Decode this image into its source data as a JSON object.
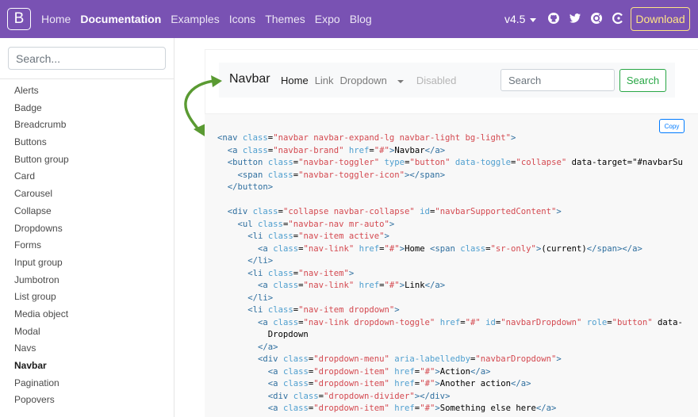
{
  "topnav": {
    "brand_letter": "B",
    "links": [
      "Home",
      "Documentation",
      "Examples",
      "Icons",
      "Themes",
      "Expo",
      "Blog"
    ],
    "active_link": "Documentation",
    "version": "v4.5",
    "icons": [
      "github-icon",
      "twitter-icon",
      "opencollective-icon",
      "slack-icon"
    ],
    "download_label": "Download"
  },
  "sidebar": {
    "search_placeholder": "Search...",
    "items": [
      "Alerts",
      "Badge",
      "Breadcrumb",
      "Buttons",
      "Button group",
      "Card",
      "Carousel",
      "Collapse",
      "Dropdowns",
      "Forms",
      "Input group",
      "Jumbotron",
      "List group",
      "Media object",
      "Modal",
      "Navs",
      "Navbar",
      "Pagination",
      "Popovers"
    ],
    "active_item": "Navbar"
  },
  "example": {
    "brand": "Navbar",
    "home": "Home",
    "link": "Link",
    "dropdown": "Dropdown",
    "disabled": "Disabled",
    "search_placeholder": "Search",
    "search_button": "Search"
  },
  "code": {
    "copy_label": "Copy",
    "lines": [
      "<nav class=\"navbar navbar-expand-lg navbar-light bg-light\">",
      "  <a class=\"navbar-brand\" href=\"#\">Navbar</a>",
      "  <button class=\"navbar-toggler\" type=\"button\" data-toggle=\"collapse\" data-target=\"#navbarSu",
      "    <span class=\"navbar-toggler-icon\"></span>",
      "  </button>",
      "",
      "  <div class=\"collapse navbar-collapse\" id=\"navbarSupportedContent\">",
      "    <ul class=\"navbar-nav mr-auto\">",
      "      <li class=\"nav-item active\">",
      "        <a class=\"nav-link\" href=\"#\">Home <span class=\"sr-only\">(current)</span></a>",
      "      </li>",
      "      <li class=\"nav-item\">",
      "        <a class=\"nav-link\" href=\"#\">Link</a>",
      "      </li>",
      "      <li class=\"nav-item dropdown\">",
      "        <a class=\"nav-link dropdown-toggle\" href=\"#\" id=\"navbarDropdown\" role=\"button\" data-",
      "          Dropdown",
      "        </a>",
      "        <div class=\"dropdown-menu\" aria-labelledby=\"navbarDropdown\">",
      "          <a class=\"dropdown-item\" href=\"#\">Action</a>",
      "          <a class=\"dropdown-item\" href=\"#\">Another action</a>",
      "          <div class=\"dropdown-divider\"></div>",
      "          <a class=\"dropdown-item\" href=\"#\">Something else here</a>"
    ]
  },
  "colors": {
    "topbar": "#7952b3",
    "download": "#ffe484",
    "success": "#28a745",
    "primary": "#007bff"
  }
}
